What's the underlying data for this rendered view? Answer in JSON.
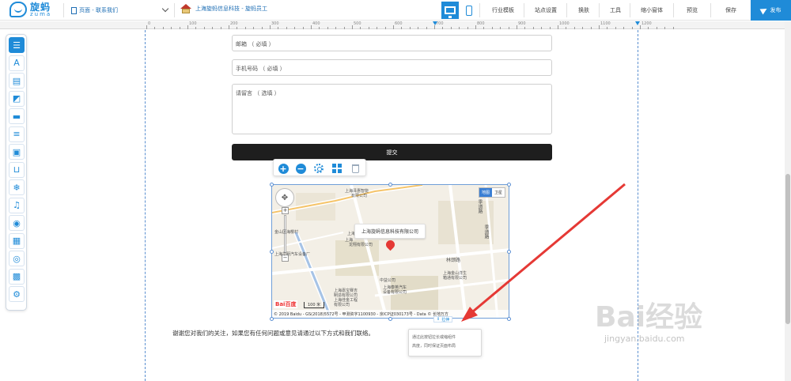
{
  "header": {
    "logo_cn": "旋蚂",
    "logo_en": "zuma",
    "page_select": "页面 - 联系我们",
    "site_name": "上海旋蚂信息科技 - 旋蚂员工",
    "menu": [
      "行业模板",
      "站点设置",
      "换肤",
      "工具",
      "缩小窗体",
      "预览",
      "保存"
    ],
    "publish": "发布"
  },
  "ruler": {
    "labels": [
      "0",
      "100",
      "200",
      "300",
      "400",
      "500",
      "600",
      "700",
      "800",
      "900",
      "1000",
      "1100",
      "1200"
    ]
  },
  "toolbox": {
    "tools": [
      "list-icon",
      "text-icon",
      "image-text-icon",
      "shapes-icon",
      "divider-icon",
      "menu-list-icon",
      "gallery-icon",
      "bag-icon",
      "snowflake-icon",
      "music-icon",
      "video-icon",
      "article-icon",
      "media-icon",
      "picture-icon",
      "search-settings-icon"
    ]
  },
  "form": {
    "email_placeholder": "邮箱 （ 必填 ）",
    "phone_placeholder": "手机号码 （ 必填 ）",
    "message_placeholder": "请留言 （ 选填 ）",
    "submit_label": "提交"
  },
  "map": {
    "map_type": [
      "地图",
      "卫星"
    ],
    "company_label": "上海旋蚂信息科技有限公司",
    "road_label": "林颈路",
    "roads_vertical": [
      "季道路",
      "季道路"
    ],
    "poi": [
      "上海泽惠智能",
      "有限公司",
      "上海",
      "金山区海樱村",
      "上海",
      "龙翔有限公司",
      "上海华明汽车设备厂",
      "中益公司",
      "上海泰英汽车",
      "设备有限公司",
      "上海金山洋生",
      "箱通有限公司",
      "上海嘉宝赛吉",
      "制造有限公司",
      "上海佳金工程",
      "有限公司"
    ],
    "scale": "100 米",
    "copyright": "© 2019 Baidu - GS(2018)5572号 - 甲测资字1100930 - 京ICP证030173号 - Data © 长地万方",
    "baidu": "Bai百度"
  },
  "stretch_label": "拉伸",
  "tooltip": {
    "line1": "通过此按钮拉长或缩组件",
    "line2": "高度，同时保证页面布局"
  },
  "footer_text": "谢谢您对我们的关注，如果您有任何问题或意见请通过以下方式和我们联络。",
  "watermark": {
    "main": "Bai经验",
    "sub": "jingyan.baidu.com"
  },
  "colors": {
    "accent": "#1f8bd8",
    "submit_bg": "#1e1e1e",
    "arrow": "#e53935"
  }
}
